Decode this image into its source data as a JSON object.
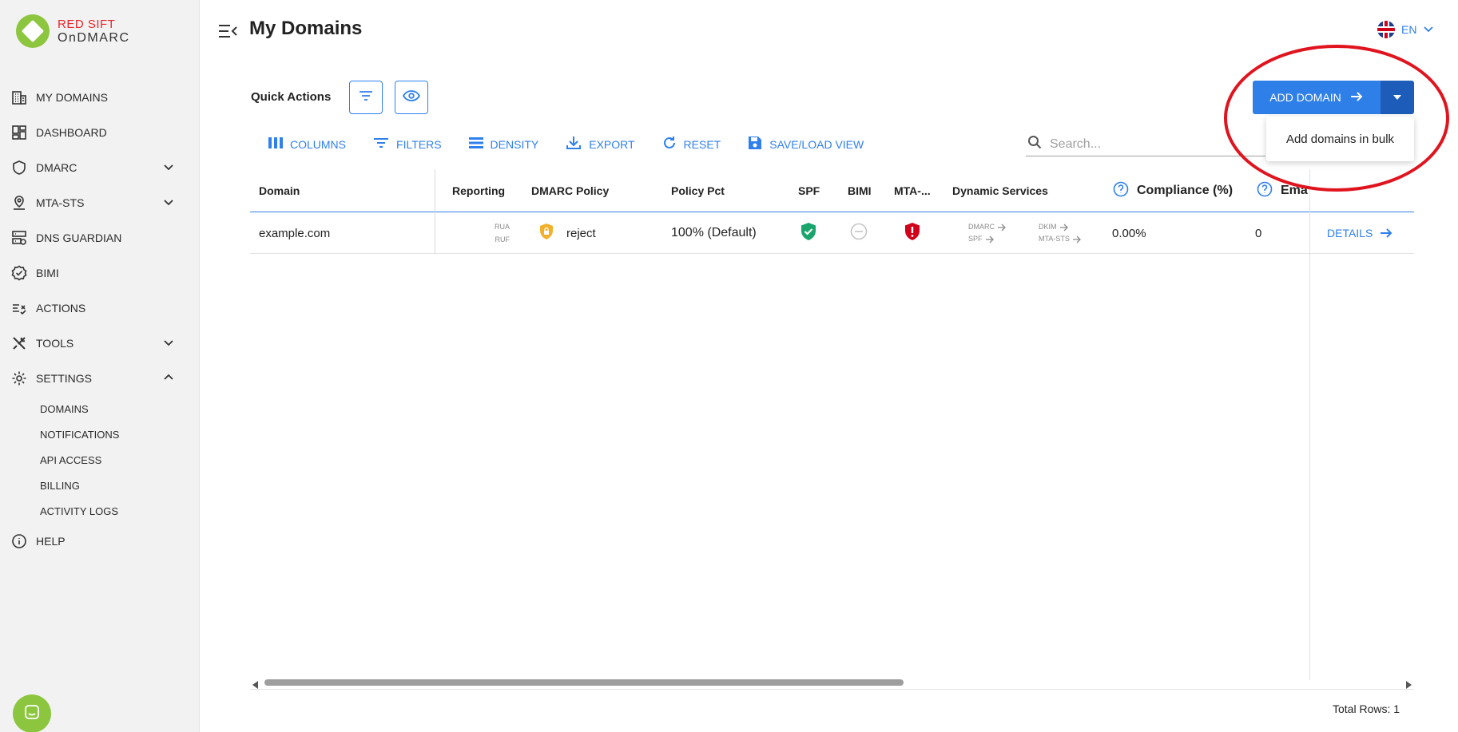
{
  "app": {
    "logo_top": "RED SIFT",
    "logo_bottom": "OnDMARC"
  },
  "sidebar": {
    "items": [
      {
        "label": "MY DOMAINS",
        "icon": "building-icon"
      },
      {
        "label": "DASHBOARD",
        "icon": "dashboard-icon"
      },
      {
        "label": "DMARC",
        "icon": "shield-icon",
        "expandable": true
      },
      {
        "label": "MTA-STS",
        "icon": "location-pin-icon",
        "expandable": true
      },
      {
        "label": "DNS GUARDIAN",
        "icon": "server-icon"
      },
      {
        "label": "BIMI",
        "icon": "verified-badge-icon"
      },
      {
        "label": "ACTIONS",
        "icon": "checklist-icon"
      },
      {
        "label": "TOOLS",
        "icon": "tools-icon",
        "expandable": true
      },
      {
        "label": "SETTINGS",
        "icon": "gear-icon",
        "expanded": true
      }
    ],
    "settings_sub": [
      "DOMAINS",
      "NOTIFICATIONS",
      "API ACCESS",
      "BILLING",
      "ACTIVITY LOGS"
    ],
    "help": "HELP"
  },
  "header": {
    "title": "My Domains",
    "language": "EN"
  },
  "quick_actions": {
    "label": "Quick Actions"
  },
  "add_domain": {
    "label": "ADD DOMAIN",
    "menu_item": "Add domains in bulk"
  },
  "toolbar": {
    "columns": "COLUMNS",
    "filters": "FILTERS",
    "density": "DENSITY",
    "export": "EXPORT",
    "reset": "RESET",
    "save_load": "SAVE/LOAD VIEW"
  },
  "search": {
    "placeholder": "Search..."
  },
  "table": {
    "headers": {
      "domain": "Domain",
      "reporting": "Reporting",
      "dmarc_policy": "DMARC Policy",
      "policy_pct": "Policy Pct",
      "spf": "SPF",
      "bimi": "BIMI",
      "mta": "MTA-...",
      "dynamic_services": "Dynamic Services",
      "compliance": "Compliance (%)",
      "emails": "Ema"
    },
    "rows": [
      {
        "domain": "example.com",
        "reporting_rua": "RUA",
        "reporting_ruf": "RUF",
        "dmarc_policy": "reject",
        "policy_pct": "100% (Default)",
        "spf_status": "pass",
        "bimi_status": "none",
        "mta_status": "error",
        "services": {
          "dmarc": "DMARC",
          "spf": "SPF",
          "dkim": "DKIM",
          "mta_sts": "MTA-STS"
        },
        "compliance": "0.00%",
        "emails": "0",
        "details": "DETAILS"
      }
    ],
    "total_rows": "Total Rows: 1"
  },
  "colors": {
    "accent": "#2f80ed",
    "sidebar_bg": "#f2f2f2",
    "annotation": "#e0141e",
    "spf_pass": "#1aa56c",
    "mta_error": "#d0021b",
    "policy_lock": "#f2b02d"
  }
}
